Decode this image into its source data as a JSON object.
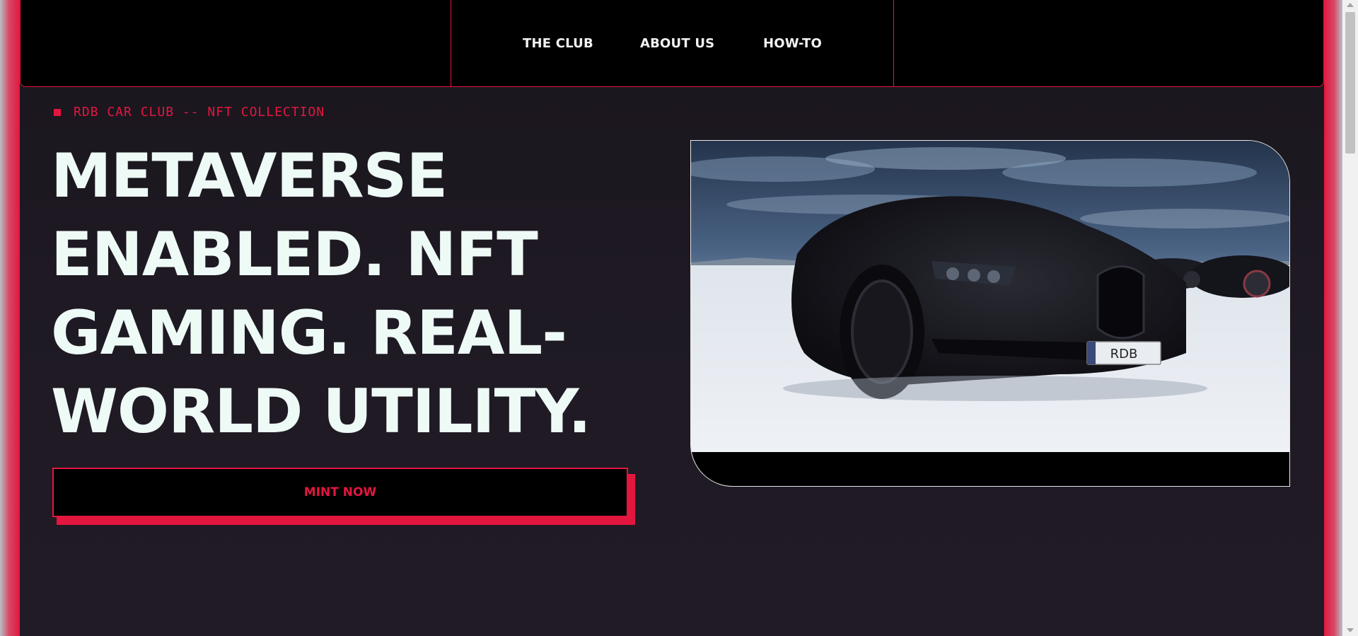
{
  "nav": {
    "links": [
      "THE CLUB",
      "ABOUT US",
      "HOW-TO"
    ]
  },
  "hero": {
    "eyebrow": "RDB CAR CLUB -- NFT COLLECTION",
    "headline_lines": [
      "METAVERSE",
      "ENABLED. NFT",
      "GAMING. REAL-",
      "WORLD UTILITY."
    ],
    "cta_label": "MINT NOW",
    "image": {
      "plate_text": "RDB",
      "plate_side": "R D B"
    }
  },
  "colors": {
    "accent": "#e3163f",
    "background": "#1c1820",
    "headline": "#eefaf6",
    "nav_bg": "#000000"
  },
  "icons": {
    "eyebrow_marker": "square-bullet-icon"
  }
}
